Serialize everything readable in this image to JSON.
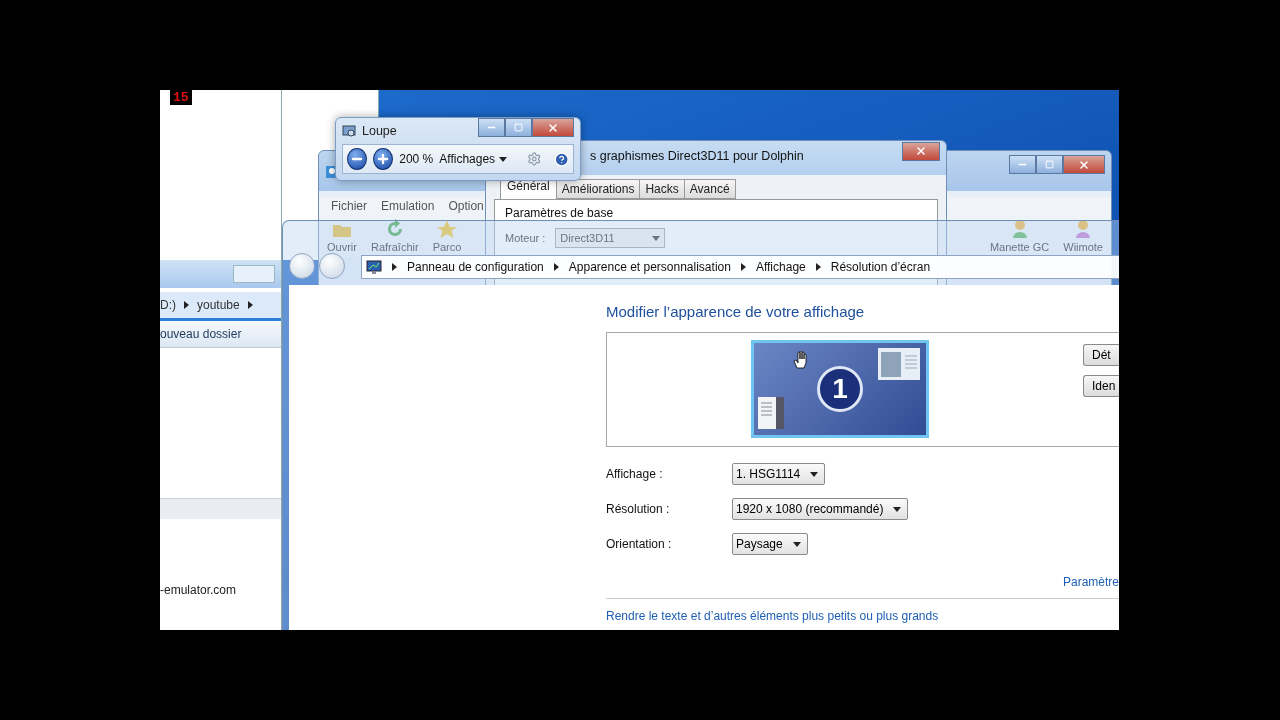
{
  "recording_counter": "15",
  "explorer": {
    "path": [
      "D:)",
      "youtube"
    ],
    "toolbar_item": "ouveau dossier",
    "footer_text": "-emulator.com"
  },
  "dolphin": {
    "menu": [
      "Fichier",
      "Emulation",
      "Option"
    ],
    "toolbar_left": [
      "Ouvrir",
      "Rafraîchir",
      "Parco"
    ],
    "toolbar_right": [
      "Manette GC",
      "Wiimote"
    ]
  },
  "graphics_dialog": {
    "title": "s graphismes Direct3D11 pour Dolphin",
    "tabs": [
      {
        "label": "Général",
        "selected": true
      },
      {
        "label": "Améliorations",
        "selected": false
      },
      {
        "label": "Hacks",
        "selected": false
      },
      {
        "label": "Avancé",
        "selected": false
      }
    ],
    "group": "Paramètres de base",
    "engine_label": "Moteur :",
    "engine_value": "Direct3D11"
  },
  "loupe": {
    "title": "Loupe",
    "zoom": "200 %",
    "views": "Affichages"
  },
  "display_settings": {
    "breadcrumb": [
      "Panneau de configuration",
      "Apparence et personnalisation",
      "Affichage",
      "Résolution d’écran"
    ],
    "heading": "Modifier l’apparence de votre affichage",
    "monitor_number": "1",
    "buttons": [
      "Dét",
      "Iden"
    ],
    "fields": [
      {
        "label": "Affichage :",
        "value": "1. HSG1114"
      },
      {
        "label": "Résolution :",
        "value": "1920 x 1080 (recommandé)"
      },
      {
        "label": "Orientation :",
        "value": "Paysage"
      }
    ],
    "advanced_link": "Paramètre",
    "text_size_link": "Rendre le texte et d’autres éléments plus petits ou plus grands"
  }
}
